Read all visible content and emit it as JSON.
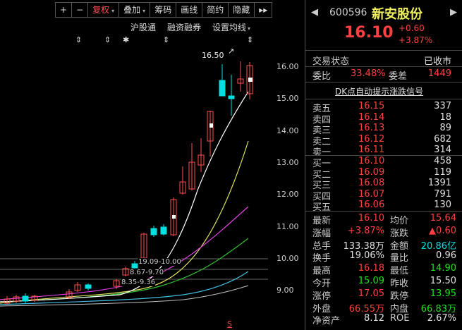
{
  "toolbar": {
    "items": [
      {
        "label": "+",
        "style": "white"
      },
      {
        "label": "−",
        "style": "white"
      },
      {
        "label": "复权",
        "style": "red",
        "caret": "▾"
      },
      {
        "label": "叠加",
        "style": "white",
        "caret": "▾"
      },
      {
        "label": "筹码",
        "style": "white"
      },
      {
        "label": "画线",
        "style": "white"
      },
      {
        "label": "简约",
        "style": "white"
      },
      {
        "label": "隐藏",
        "style": "white"
      },
      {
        "label": "▸▸",
        "style": "white"
      }
    ]
  },
  "subbar": {
    "hgt": "沪股通",
    "rzrq": "融资融券",
    "ma_settings": "设置均线",
    "caret": "▾"
  },
  "chart": {
    "high_label": "16.50",
    "arrow": "↗",
    "yticks": [
      "16.00",
      "15.00",
      "14.00",
      "13.00",
      "12.00",
      "11.00",
      "10.00",
      "9.00"
    ],
    "annotations": [
      "19.09-10.00",
      "8.67-9.70",
      "8.35-9.36"
    ],
    "bottom_mark": "S"
  },
  "panel": {
    "back_icon": "◀",
    "forward_icon": "▶",
    "code": "600596",
    "name": "新安股份",
    "price": "16.10",
    "change": "+0.60",
    "change_pct": "+3.87%",
    "trade_status_label": "交易状态",
    "trade_status": "已收市",
    "weibi_label": "委比",
    "weibi": "33.48%",
    "weicha_label": "委差",
    "weicha": "1449",
    "dk_signal": "DK点自动提示涨跌信号",
    "asks": [
      {
        "label": "卖五",
        "price": "16.15",
        "vol": "337"
      },
      {
        "label": "卖四",
        "price": "16.14",
        "vol": "18"
      },
      {
        "label": "卖三",
        "price": "16.13",
        "vol": "89"
      },
      {
        "label": "卖二",
        "price": "16.12",
        "vol": "682"
      },
      {
        "label": "卖一",
        "price": "16.11",
        "vol": "314"
      }
    ],
    "bids": [
      {
        "label": "买一",
        "price": "16.10",
        "vol": "458"
      },
      {
        "label": "买二",
        "price": "16.09",
        "vol": "119"
      },
      {
        "label": "买三",
        "price": "16.08",
        "vol": "1391"
      },
      {
        "label": "买四",
        "price": "16.07",
        "vol": "791"
      },
      {
        "label": "买五",
        "price": "16.06",
        "vol": "130"
      }
    ],
    "stats": [
      {
        "l1": "最新",
        "v1": "16.10",
        "c1": "red",
        "l2": "均价",
        "v2": "15.64",
        "c2": "red"
      },
      {
        "l1": "涨幅",
        "v1": "+3.87%",
        "c1": "red",
        "l2": "涨跌",
        "v2": "▲0.60",
        "c2": "red"
      },
      {
        "l1": "总手",
        "v1": "133.38万",
        "c1": "white",
        "l2": "金额",
        "v2": "20.86亿",
        "c2": "cyan"
      },
      {
        "l1": "换手",
        "v1": "19.06%",
        "c1": "white",
        "l2": "量比",
        "v2": "0.96",
        "c2": "white"
      },
      {
        "l1": "最高",
        "v1": "16.18",
        "c1": "red",
        "l2": "最低",
        "v2": "14.90",
        "c2": "green"
      },
      {
        "l1": "今开",
        "v1": "15.09",
        "c1": "green",
        "l2": "昨收",
        "v2": "15.50",
        "c2": "white"
      },
      {
        "l1": "涨停",
        "v1": "17.05",
        "c1": "red",
        "l2": "跌停",
        "v2": "13.95",
        "c2": "green"
      },
      {
        "l1": "外盘",
        "v1": "66.55万",
        "c1": "red",
        "l2": "内盘",
        "v2": "66.83万",
        "c2": "green"
      },
      {
        "l1": "净资产",
        "v1": "8.12",
        "c1": "white",
        "l2": "ROE",
        "v2": "2.67%",
        "c2": "white"
      }
    ],
    "colors": {
      "up": "#ff4040",
      "down": "#20e020",
      "cyan": "#00e0e0"
    }
  }
}
